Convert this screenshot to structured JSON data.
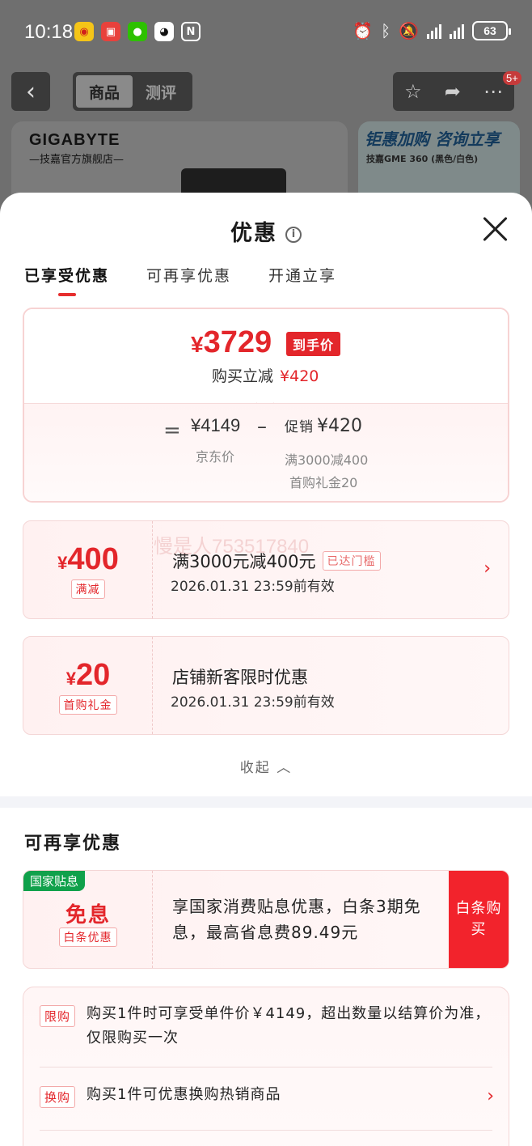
{
  "status_bar": {
    "time": "10:18",
    "battery": "63"
  },
  "top_nav": {
    "back_icon": "‹",
    "seg_tabs": [
      "商品",
      "测评"
    ],
    "badge": "5+"
  },
  "banner": {
    "brand": "GIGABYTE",
    "brand_sub": "—技嘉官方旗舰店—",
    "promo_title": "钜惠加购 咨询立享",
    "promo_sub": "技嘉GME 360 (黑色/白色)"
  },
  "sheet": {
    "title": "优惠",
    "tabs": [
      "已享受优惠",
      "可再享优惠",
      "开通立享"
    ]
  },
  "summary": {
    "final_price_yen": "¥",
    "final_price": "3729",
    "price_tag": "到手价",
    "buy_reduce_label": "购买立减",
    "buy_reduce_amount": "¥420",
    "eq": "=",
    "jd_price": "¥4149",
    "jd_label": "京东价",
    "minus": "–",
    "promo_label": "促销",
    "promo_amount": "¥420",
    "promo_line1": "满3000减400",
    "promo_line2": "首购礼金20"
  },
  "watermark": "慢是人753517840",
  "coupons": [
    {
      "yen": "¥",
      "amount": "400",
      "chip": "满减",
      "title": "满3000元减400元",
      "tag": "已达门槛",
      "valid": "2026.01.31  23:59前有效"
    },
    {
      "yen": "¥",
      "amount": "20",
      "chip": "首购礼金",
      "title": "店铺新客限时优惠",
      "valid": "2026.01.31  23:59前有效"
    }
  ],
  "collapse_label": "收起 ︿",
  "more_section": {
    "title": "可再享优惠",
    "subsidy": {
      "corner": "国家贴息",
      "big": "免息",
      "chip": "白条优惠",
      "desc": "享国家消费贴息优惠，白条3期免息，最高省息费89.49元",
      "button": "白条购买"
    },
    "rules": [
      {
        "tag": "限购",
        "text": "购买1件时可享受单件价￥4149，超出数量以结算价为准，仅限购买一次"
      },
      {
        "tag": "换购",
        "text": "购买1件可优惠换购热销商品"
      }
    ]
  }
}
